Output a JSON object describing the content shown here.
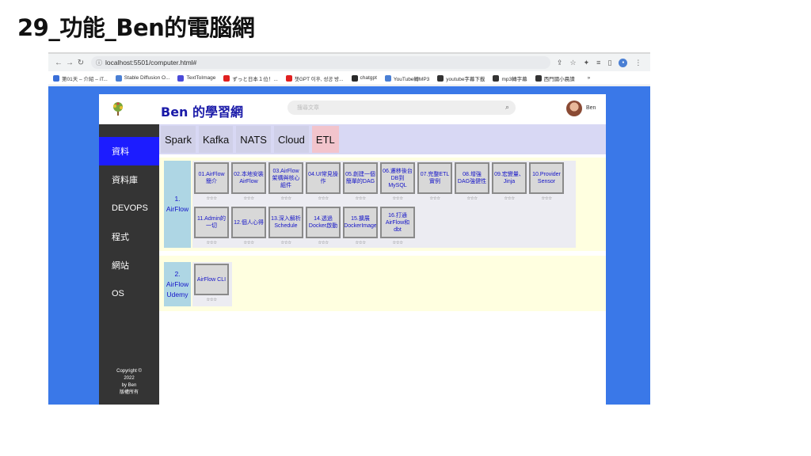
{
  "slide": {
    "title": "29_功能_Ben的電腦網"
  },
  "browser": {
    "url": "localhost:5501/computer.html#",
    "bookmarks": [
      "第01天 – 介紹 – iT...",
      "Stable Diffusion O...",
      "TextToImage",
      "ずっと日本１位！...",
      "챗GPT 이후, 성공 방...",
      "chatgpt",
      "YouTube轉MP3",
      "youtube字幕下載",
      "mp3轉字幕",
      "西門國小晨讀"
    ],
    "bookmark_colors": [
      "#3a6fd8",
      "#4a7fd4",
      "#4a4ad8",
      "#e02020",
      "#e02020",
      "#2a2a2a",
      "#4a7fd4",
      "#333333",
      "#333333",
      "#333333"
    ],
    "more": "»"
  },
  "site": {
    "title": "Ben 的學習網",
    "search_placeholder": "搜尋文章",
    "user": "Ben",
    "sidebar": [
      "資料",
      "資料庫",
      "DEVOPS",
      "程式",
      "網站",
      "OS"
    ],
    "copyright": [
      "Copyright ©",
      "2022",
      "by Ben",
      "版權所有"
    ],
    "tabs": [
      "Spark",
      "Kafka",
      "NATS",
      "Cloud",
      "ETL"
    ],
    "sections": [
      {
        "label": "1. AirFlow",
        "cards": [
          {
            "text": "01.AirFlow簡介",
            "stars": "☆☆☆"
          },
          {
            "text": "02.本地安裝AirFlow",
            "stars": "☆☆☆"
          },
          {
            "text": "03.AirFlow架構與核心組件",
            "stars": "☆☆☆"
          },
          {
            "text": "04.UI常見操作",
            "stars": "☆☆☆"
          },
          {
            "text": "05.創建一個簡單的DAG",
            "stars": "☆☆☆"
          },
          {
            "text": "06.遷移後台DB到MySQL",
            "stars": "☆☆☆"
          },
          {
            "text": "07.完整ETL實例",
            "stars": "☆☆☆"
          },
          {
            "text": "08.增強DAG強健性",
            "stars": "☆☆☆"
          },
          {
            "text": "09.宏變量、Jinja",
            "stars": "☆☆☆"
          },
          {
            "text": "10.Provider Sensor",
            "stars": "☆☆☆"
          },
          {
            "text": "11.Admin的一切",
            "stars": "☆☆☆"
          },
          {
            "text": "12.個人心得",
            "stars": "☆☆☆"
          },
          {
            "text": "13.深入解析Schedule",
            "stars": "☆☆☆"
          },
          {
            "text": "14.透過Docker啟動",
            "stars": "☆☆☆"
          },
          {
            "text": "15.擴展DockerImage",
            "stars": "☆☆☆"
          },
          {
            "text": "16.打通AirFlow和dbt",
            "stars": "☆☆☆"
          }
        ]
      },
      {
        "label": "2. AirFlow Udemy",
        "cards": [
          {
            "text": "AirFlow CLI",
            "stars": "☆☆☆"
          }
        ]
      }
    ]
  }
}
